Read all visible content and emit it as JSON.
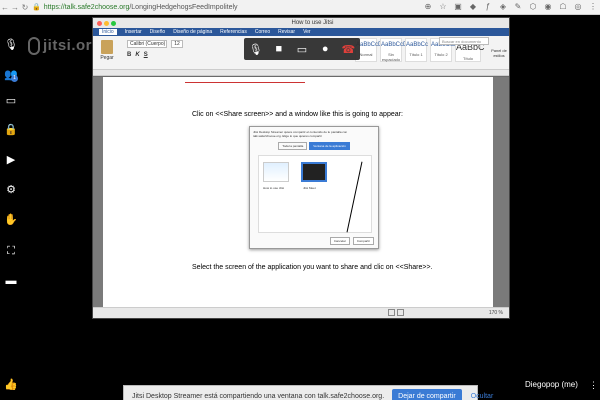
{
  "browser": {
    "protocol": "https://",
    "domain": "talk.safe2choose.org",
    "path": "/LongingHedgehogsFeedImpolitely"
  },
  "icons": {
    "back": "back-arrow-icon",
    "forward": "forward-arrow-icon",
    "reload": "reload-icon",
    "lock": "lock-icon",
    "star": "star-icon"
  },
  "logo": {
    "text": "jitsi.or"
  },
  "toolbar": {
    "badge": "1",
    "buttons": [
      "people-icon",
      "chat-icon",
      "lock-icon",
      "record-icon",
      "settings-icon",
      "raise-hand-icon",
      "fullscreen-icon",
      "filmstrip-icon"
    ]
  },
  "shared_window": {
    "title": "How to use Jitsi",
    "tabs": [
      "Inicio",
      "Insertar",
      "Diseño",
      "Diseño de página",
      "Referencias",
      "Correo",
      "Revisar",
      "Ver"
    ],
    "font_name": "Calibri (Cuerpo)",
    "font_size": "12",
    "paste_label": "Pegar",
    "search_placeholder": "Buscar en documento",
    "panel_label": "Panel de estilos",
    "styles": [
      {
        "preview": "AaBbCcDc",
        "name": "Normal"
      },
      {
        "preview": "AaBbCcDc",
        "name": "Sin espaciado"
      },
      {
        "preview": "AaBbCc",
        "name": "Título 1"
      },
      {
        "preview": "AaBbCcD",
        "name": "Título 2"
      },
      {
        "preview": "AaBbC",
        "name": "Título"
      }
    ],
    "doc_line1": "Clic on <<Share screen>> and a window like this is going to appear:",
    "doc_line2": "Select the screen of the application you want to share and clic on <<Share>>.",
    "dialog": {
      "text": "Jitsi Desktop Streamer quiere compartir el contenido de tu pantalla con talk.safe2choose.org. Elige lo que quieres compartir",
      "tab1": "Toda la pantalla",
      "tab2": "Ventana de la aplicación",
      "thumb1_label": "How to use Jitsi",
      "thumb2_label": "Jitsi Meet",
      "cancel": "Cancelar",
      "share": "Compartir"
    },
    "zoom": "170 %"
  },
  "floating_bar": [
    "microphone-icon",
    "camera-icon",
    "share-screen-icon",
    "participants-icon",
    "hangup-icon"
  ],
  "user": {
    "name": "Diegopop (me)"
  },
  "share_bar": {
    "message": "Jitsi Desktop Streamer está compartiendo una ventana con talk.safe2choose.org.",
    "stop_label": "Dejar de compartir",
    "hide_label": "Ocultar"
  }
}
